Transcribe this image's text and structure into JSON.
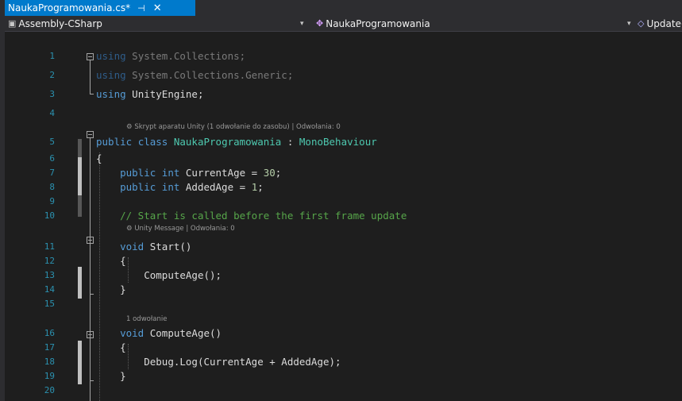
{
  "tab": {
    "title": "NaukaProgramowania.cs*",
    "pin_icon": "pin-icon",
    "close_icon": "close-icon"
  },
  "navbar": {
    "project": "Assembly-CSharp",
    "class_name": "NaukaProgramowania",
    "member": "Update()"
  },
  "lines": [
    {
      "num": "1"
    },
    {
      "num": "2"
    },
    {
      "num": "3"
    },
    {
      "num": "4"
    },
    {
      "num": "5"
    },
    {
      "num": "6"
    },
    {
      "num": "7"
    },
    {
      "num": "8"
    },
    {
      "num": "9"
    },
    {
      "num": "10"
    },
    {
      "num": "11"
    },
    {
      "num": "12"
    },
    {
      "num": "13"
    },
    {
      "num": "14"
    },
    {
      "num": "15"
    },
    {
      "num": "16"
    },
    {
      "num": "17"
    },
    {
      "num": "18"
    },
    {
      "num": "19"
    },
    {
      "num": "20"
    }
  ],
  "code": {
    "l1_kw": "using",
    "l1_rest": " System.Collections;",
    "l2_kw": "using",
    "l2_rest": " System.Collections.Generic;",
    "l3_kw": "using",
    "l3_rest": " UnityEngine;",
    "l5_kw1": "public",
    "l5_kw2": "class",
    "l5_name": "NaukaProgramowania",
    "l5_sep": " : ",
    "l5_base": "MonoBehaviour",
    "l6": "{",
    "l7_kw1": "public",
    "l7_kw2": "int",
    "l7_rest": " CurrentAge = ",
    "l7_num": "30",
    "l7_end": ";",
    "l8_kw1": "public",
    "l8_kw2": "int",
    "l8_rest": " AddedAge = ",
    "l8_num": "1",
    "l8_end": ";",
    "l10": "// Start is called before the first frame update",
    "l11_kw": "void",
    "l11_rest": " Start()",
    "l12": "{",
    "l13": "ComputeAge();",
    "l14": "}",
    "l16_kw": "void",
    "l16_rest": " ComputeAge()",
    "l17": "{",
    "l18": "Debug.Log(CurrentAge + AddedAge);",
    "l19": "}"
  },
  "codelens": {
    "class_lens": "Skrypt aparatu Unity (1 odwołanie do zasobu) | Odwołania: 0",
    "start_lens": "Unity Message | Odwołania: 0",
    "compute_lens": "1 odwołanie"
  }
}
